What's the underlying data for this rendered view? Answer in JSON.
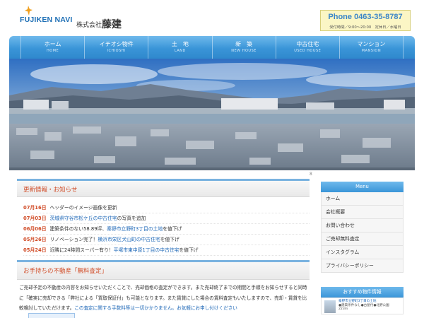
{
  "header": {
    "logo_text": "FUJIKEN NAVI",
    "company_prefix": "株式会社",
    "company_name": "藤建",
    "phone": "Phone 0463-35-8787",
    "hours": "受付時間／9:00〜20:00　定休日／水曜日"
  },
  "nav": {
    "items": [
      {
        "label": "ホーム",
        "sub": "HOME"
      },
      {
        "label": "イチオシ物件",
        "sub": "ICHIOSHI"
      },
      {
        "label": "土　地",
        "sub": "LAND"
      },
      {
        "label": "新　築",
        "sub": "NEW HOUSE"
      },
      {
        "label": "中古住宅",
        "sub": "USED HOUSE"
      },
      {
        "label": "マンション",
        "sub": "MANSION"
      }
    ]
  },
  "hero": {
    "counter": "8"
  },
  "news": {
    "title": "更新情報・お知らせ",
    "items": [
      {
        "date": "07月16日",
        "parts": [
          {
            "text": "ヘッダーのイメージ画像を更新",
            "link": false
          }
        ]
      },
      {
        "date": "07月03日",
        "parts": [
          {
            "text": "茨城県守谷市松ケ丘の中古住宅",
            "link": true
          },
          {
            "text": "の写真を追加",
            "link": false
          }
        ]
      },
      {
        "date": "06月06日",
        "parts": [
          {
            "text": "建築条件のない58.89坪、",
            "link": false
          },
          {
            "text": "秦野市立野町3丁目の土地",
            "link": true
          },
          {
            "text": "を値下げ",
            "link": false
          }
        ]
      },
      {
        "date": "05月26日",
        "parts": [
          {
            "text": "リノベーション完了！",
            "link": false
          },
          {
            "text": "横浜市栄区犬山町の中古住宅",
            "link": true
          },
          {
            "text": "を値下げ",
            "link": false
          }
        ]
      },
      {
        "date": "05月24日",
        "parts": [
          {
            "text": "近隣に24時間スーパー有り！",
            "link": false
          },
          {
            "text": "平塚市東中原1丁目の中古住宅",
            "link": true
          },
          {
            "text": "を値下げ",
            "link": false
          }
        ]
      }
    ]
  },
  "assess": {
    "title": "お手持ちの不動産「無料査定」",
    "text": "ご売却予定の不動産の内容をお知らせいただくことで、売却価格の査定ができます。また売却終了までの期間と手順をお知らせすると同時に「確実に売却できる「弊社による「買取保証付」も可能となります。また賃貸にした場合の賃料査定もいたしますので、売却・賃貸を比較検討していただけます。",
    "link_text": "この査定に関する手数料等は一切かかりません。お気軽にお申し付けください"
  },
  "sidebar": {
    "menu_title": "Menu",
    "menu_items": [
      "ホーム",
      "会社概要",
      "お問い合わせ",
      "ご売却無料査定",
      "インスタグラム",
      "プライバシーポリシー"
    ],
    "reco_title": "おすすめ物件情報",
    "reco_item": {
      "title": "秦野市立野町3丁目の土地",
      "sub": "●建築条件なし●古屋付●北野公園",
      "area": "223m"
    }
  },
  "colors": {
    "accent": "#3a95d8",
    "news_date": "#d04a25",
    "link": "#1d67b7",
    "phone_bg": "#fbf6c5"
  }
}
